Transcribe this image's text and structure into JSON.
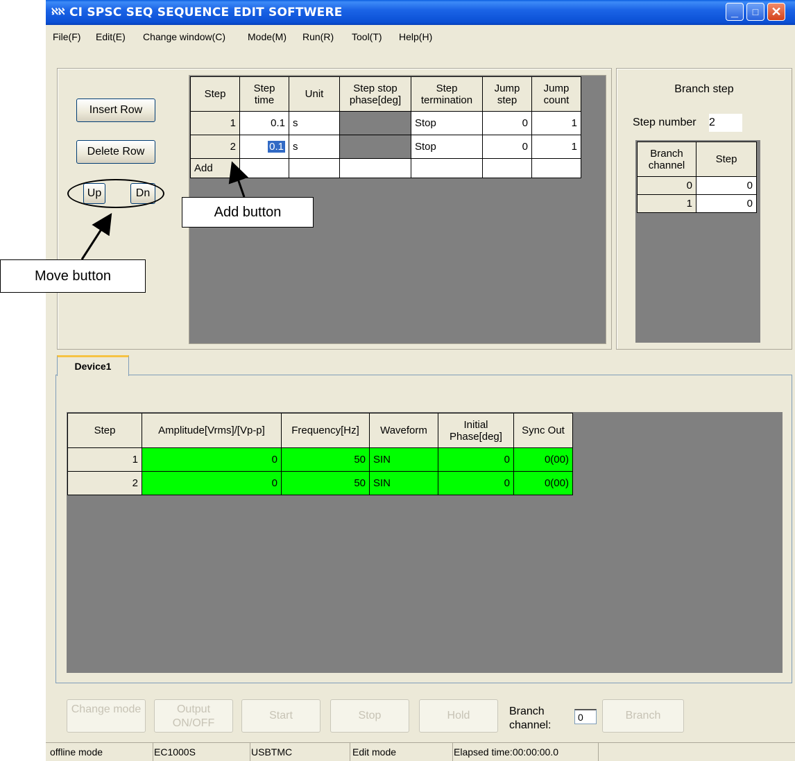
{
  "window": {
    "title": "CI SPSC SEQ SEQUENCE EDIT SOFTWERE",
    "logo": "ℵℵ"
  },
  "menu": [
    "File(F)",
    "Edit(E)",
    "Change window(C)",
    "Mode(M)",
    "Run(R)",
    "Tool(T)",
    "Help(H)"
  ],
  "left_buttons": {
    "insert_row": "Insert Row",
    "delete_row": "Delete Row",
    "up": "Up",
    "dn": "Dn"
  },
  "step_table": {
    "headers": [
      "Step",
      "Step time",
      "Unit",
      "Step stop phase[deg]",
      "Step termination",
      "Jump step",
      "Jump count"
    ],
    "rows": [
      {
        "step": "1",
        "time": "0.1",
        "unit": "s",
        "phase": "",
        "termination": "Stop",
        "jump_step": "0",
        "jump_count": "1"
      },
      {
        "step": "2",
        "time": "0.1",
        "unit": "s",
        "phase": "",
        "termination": "Stop",
        "jump_step": "0",
        "jump_count": "1"
      }
    ],
    "add_label": "Add"
  },
  "branch_panel": {
    "title": "Branch step",
    "step_number_label": "Step number",
    "step_number_value": "2",
    "headers": [
      "Branch channel",
      "Step"
    ],
    "rows": [
      {
        "channel": "0",
        "step": "0"
      },
      {
        "channel": "1",
        "step": "0"
      }
    ]
  },
  "callouts": {
    "add_button": "Add button",
    "move_button": "Move button"
  },
  "device_tab": {
    "label": "Device1"
  },
  "device_table": {
    "headers": [
      "Step",
      "Amplitude[Vrms]/[Vp-p]",
      "Frequency[Hz]",
      "Waveform",
      "Initial Phase[deg]",
      "Sync Out"
    ],
    "rows": [
      {
        "step": "1",
        "amplitude": "0",
        "frequency": "50",
        "waveform": "SIN",
        "phase": "0",
        "sync": "0(00)"
      },
      {
        "step": "2",
        "amplitude": "0",
        "frequency": "50",
        "waveform": "SIN",
        "phase": "0",
        "sync": "0(00)"
      }
    ],
    "row_color": "#00ff00"
  },
  "bottom_buttons": {
    "change_mode": "Change mode",
    "output": "Output ON/OFF",
    "start": "Start",
    "stop": "Stop",
    "hold": "Hold",
    "branch_channel_label": "Branch channel:",
    "branch_channel_value": "0",
    "branch": "Branch"
  },
  "status": [
    "offline mode",
    "EC1000S",
    "USBTMC",
    "Edit mode",
    "Elapsed time:00:00:00.0"
  ]
}
